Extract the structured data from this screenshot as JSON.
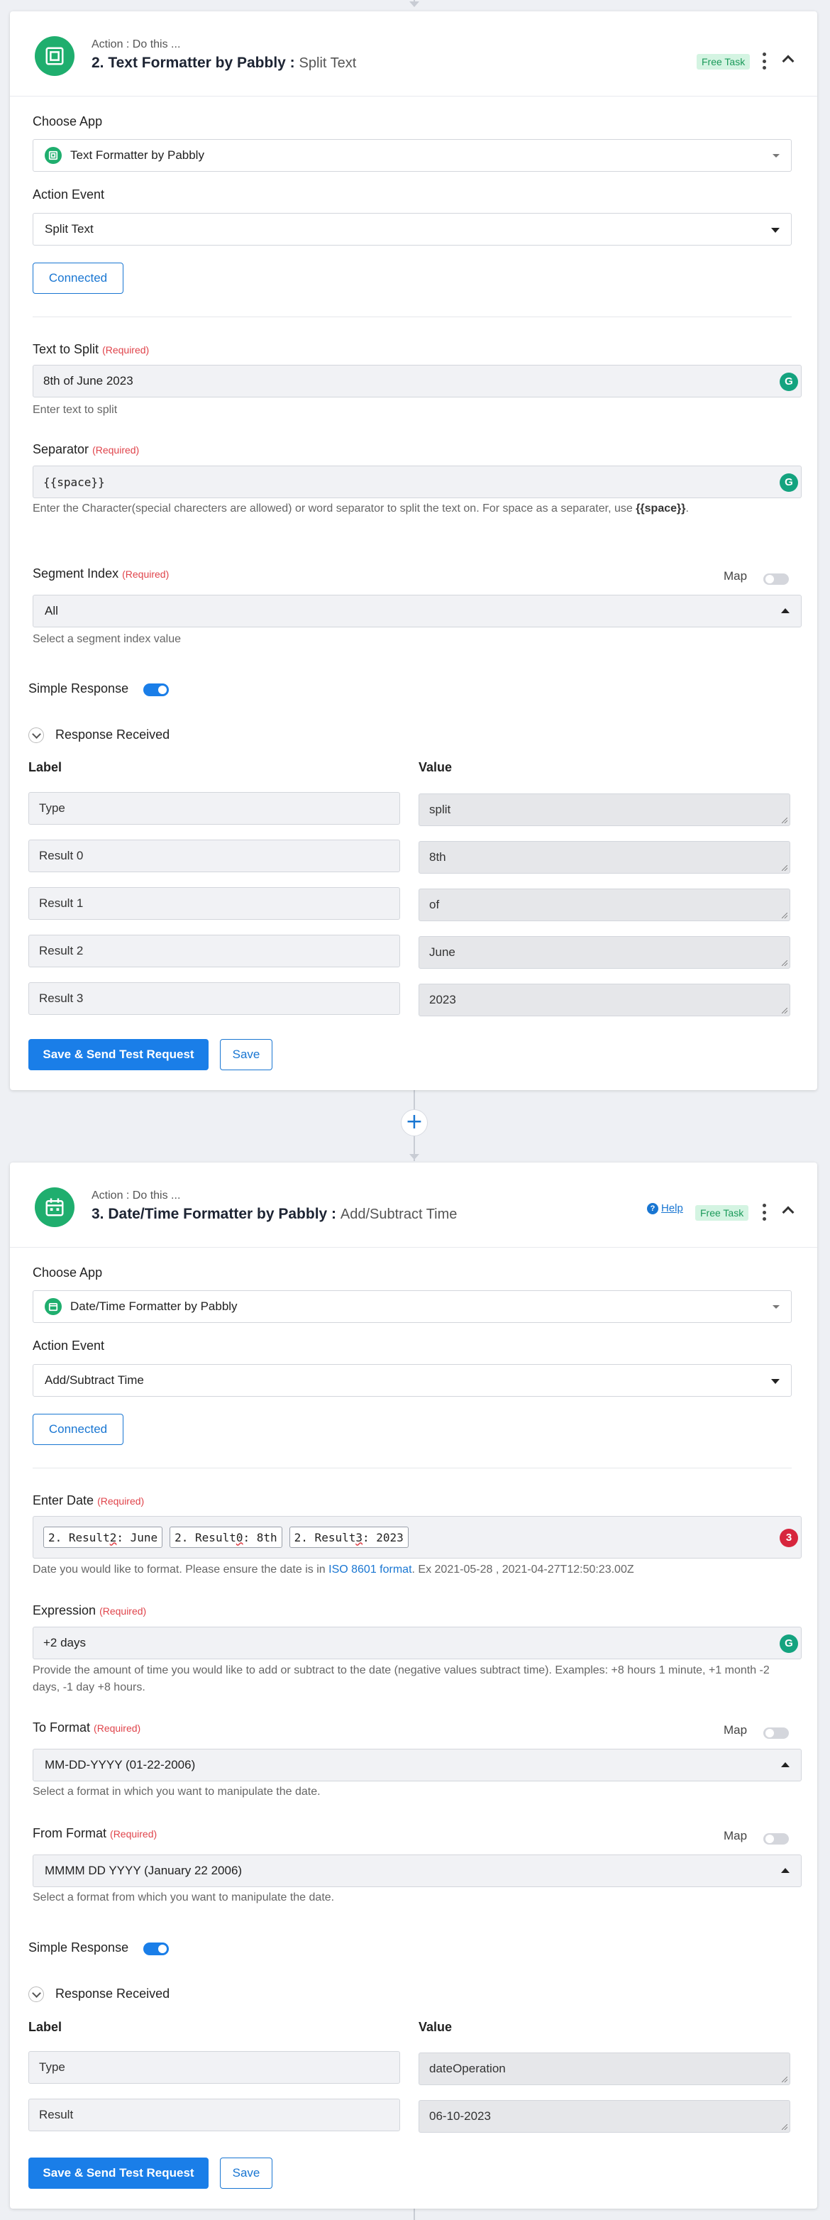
{
  "step2": {
    "head_sub": "Action : Do this ...",
    "title": "2. Text Formatter by Pabbly :",
    "event": "Split Text",
    "badge": "Free Task",
    "choose_app_label": "Choose App",
    "app_value": "Text Formatter by Pabbly",
    "action_event_label": "Action Event",
    "action_event_value": "Split Text",
    "connected_label": "Connected",
    "fields": {
      "text_to_split_label": "Text to Split",
      "text_to_split_required": "(Required)",
      "text_to_split_value": "8th of June 2023",
      "text_to_split_hint": "Enter text to split",
      "separator_label": "Separator",
      "separator_required": "(Required)",
      "separator_value": "{{space}}",
      "separator_hint_1": "Enter the Character(special charecters are allowed) or word separator to split the text on. For space as a separater, use",
      "separator_hint_bold": "{{space}}",
      "separator_hint_end": ".",
      "segment_label": "Segment Index",
      "segment_required": "(Required)",
      "segment_value": "All",
      "segment_hint": "Select a segment index value",
      "map_label": "Map"
    },
    "simple_response_label": "Simple Response",
    "response_received_label": "Response Received",
    "col_label": "Label",
    "col_value": "Value",
    "rows": [
      {
        "label": "Type",
        "value": "split"
      },
      {
        "label": "Result 0",
        "value": "8th"
      },
      {
        "label": "Result 1",
        "value": "of"
      },
      {
        "label": "Result 2",
        "value": "June"
      },
      {
        "label": "Result 3",
        "value": "2023"
      }
    ],
    "save_send_label": "Save & Send Test Request",
    "save_label": "Save"
  },
  "connector": {
    "plus": "+"
  },
  "step3": {
    "head_sub": "Action : Do this ...",
    "title": "3. Date/Time Formatter by Pabbly :",
    "event": "Add/Subtract Time",
    "help_label": "Help",
    "badge": "Free Task",
    "choose_app_label": "Choose App",
    "app_value": "Date/Time Formatter by Pabbly",
    "action_event_label": "Action Event",
    "action_event_value": "Add/Subtract Time",
    "connected_label": "Connected",
    "fields": {
      "enter_date_label": "Enter Date",
      "enter_date_required": "(Required)",
      "chips": [
        {
          "pre": "2. Result ",
          "num": "2",
          "post": " : June"
        },
        {
          "pre": "2. Result ",
          "num": "0",
          "post": " : 8th"
        },
        {
          "pre": "2. Result ",
          "num": "3",
          "post": " : 2023"
        }
      ],
      "enter_date_badge": "3",
      "enter_date_hint_1": "Date you would like to format. Please ensure the date is in",
      "enter_date_hint_link": "ISO 8601 format",
      "enter_date_hint_2": ". Ex 2021-05-28 , 2021-04-27T12:50:23.00Z",
      "expression_label": "Expression",
      "expression_required": "(Required)",
      "expression_value": "+2 days",
      "expression_hint": "Provide the amount of time you would like to add or subtract to the date (negative values subtract time). Examples: +8 hours 1 minute, +1 month -2 days, -1 day +8 hours.",
      "to_format_label": "To Format",
      "to_format_required": "(Required)",
      "to_format_value": "MM-DD-YYYY (01-22-2006)",
      "to_format_hint": "Select a format in which you want to manipulate the date.",
      "from_format_label": "From Format",
      "from_format_required": "(Required)",
      "from_format_value": "MMMM DD YYYY (January 22 2006)",
      "from_format_hint": "Select a format from which you want to manipulate the date.",
      "map_label": "Map"
    },
    "simple_response_label": "Simple Response",
    "response_received_label": "Response Received",
    "col_label": "Label",
    "col_value": "Value",
    "rows": [
      {
        "label": "Type",
        "value": "dateOperation"
      },
      {
        "label": "Result",
        "value": "06-10-2023"
      }
    ],
    "save_send_label": "Save & Send Test Request",
    "save_label": "Save"
  },
  "colors": {
    "accent": "#1a7ee8",
    "app_green": "#1fae6e",
    "required": "#e0444b",
    "badge_bg": "#d4f4e2"
  }
}
